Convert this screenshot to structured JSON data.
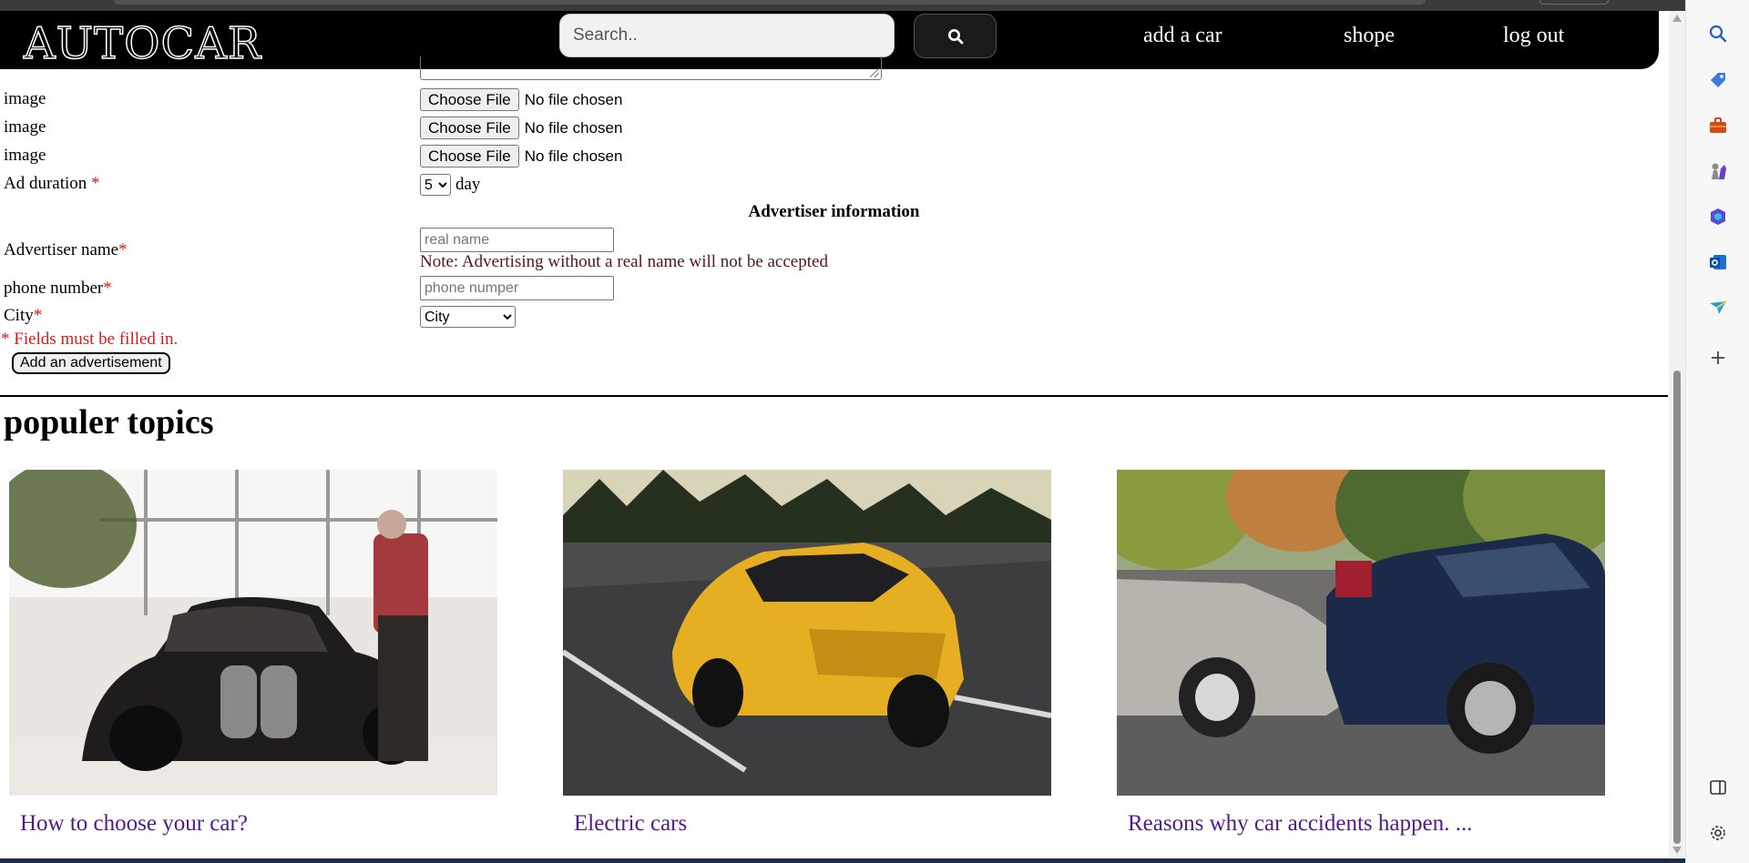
{
  "navbar": {
    "logo": "AUTOCAR",
    "search_placeholder": "Search..",
    "links": [
      "add a car",
      "shope",
      "log out"
    ]
  },
  "form": {
    "image_rows": [
      {
        "label": "image",
        "button": "Choose File",
        "status": "No file chosen"
      },
      {
        "label": "image",
        "button": "Choose File",
        "status": "No file chosen"
      },
      {
        "label": "image",
        "button": "Choose File",
        "status": "No file chosen"
      }
    ],
    "ad_duration": {
      "label": "Ad duration ",
      "required_mark": "*",
      "value": "5",
      "unit": "day"
    },
    "section_heading": "Advertiser information",
    "advertiser_name": {
      "label": "Advertiser name",
      "required_mark": "*",
      "placeholder": "real name",
      "note": "Note: Advertising without a real name will not be accepted"
    },
    "phone": {
      "label": "phone number",
      "required_mark": "*",
      "placeholder": "phone numper"
    },
    "city": {
      "label": "City",
      "required_mark": "*",
      "value": "City"
    },
    "required_note": "* Fields must be filled in.",
    "submit_label": "Add an advertisement"
  },
  "topics": {
    "title": "populer topics",
    "cards": [
      {
        "caption": "How to choose your car?"
      },
      {
        "caption": "Electric cars"
      },
      {
        "caption": "Reasons why car accidents happen. ..."
      }
    ]
  },
  "colors": {
    "navbar_bg": "#000000",
    "required": "#e21818",
    "note": "#5a1515",
    "link_caption": "#52198a"
  },
  "sidebar_icons": [
    "search-icon",
    "tag-icon",
    "briefcase-icon",
    "chess-icon",
    "copilot-icon",
    "outlook-icon",
    "send-icon",
    "plus-icon",
    "split-view-icon",
    "settings-icon"
  ]
}
